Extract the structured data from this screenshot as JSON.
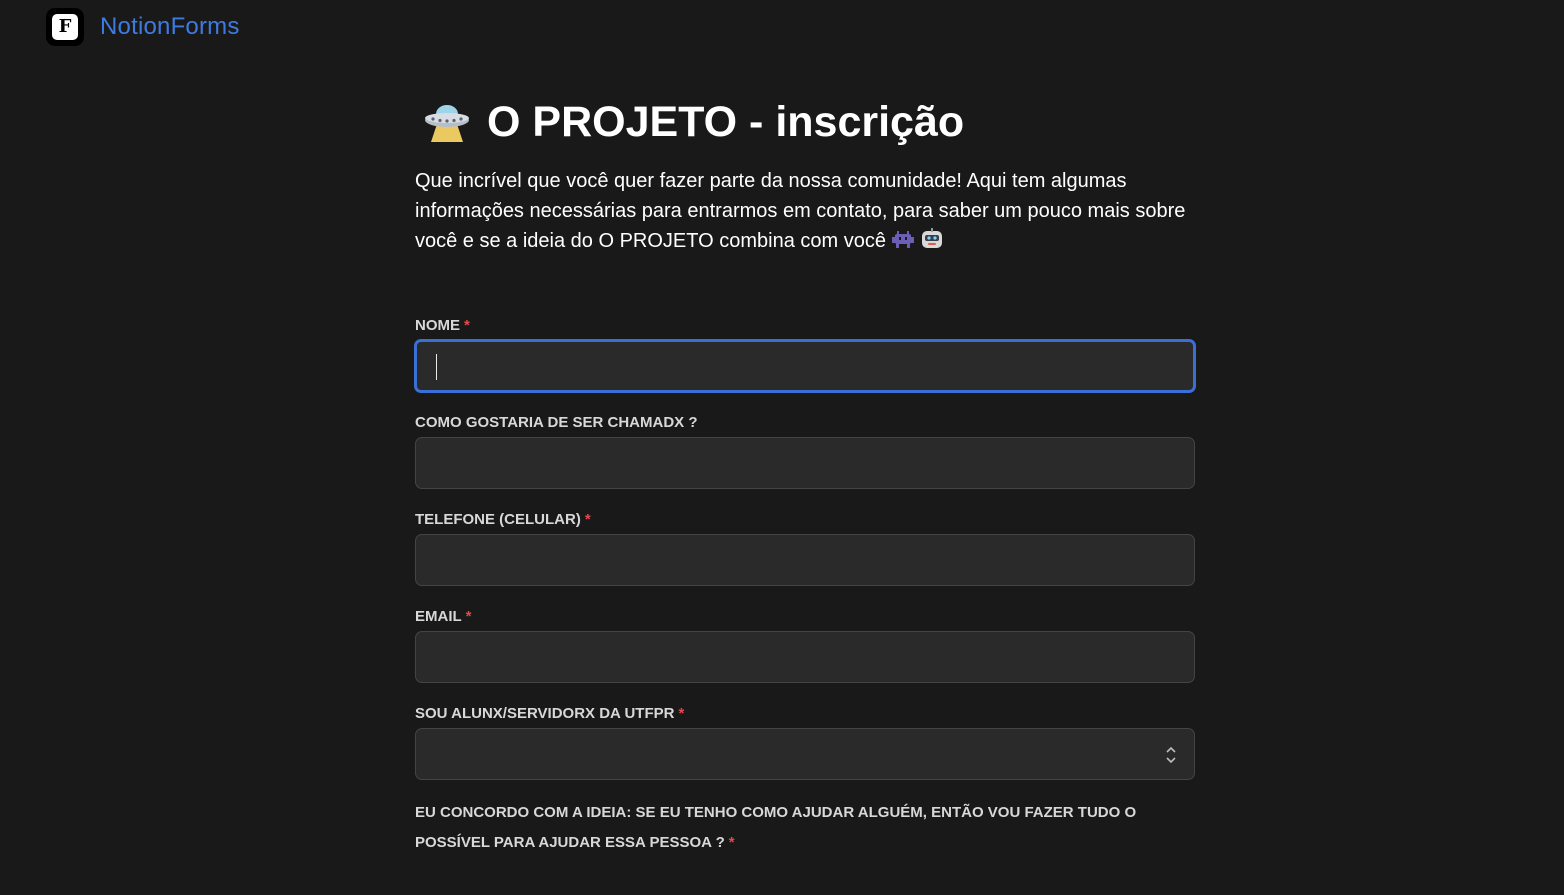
{
  "brand": {
    "logo_letter": "F",
    "name": "NotionForms",
    "color": "#3e7be0"
  },
  "page": {
    "title_icon": "ufo-icon",
    "title": "O PROJETO - inscrição",
    "description": "Que incrível que você quer fazer parte da nossa comunidade! Aqui tem algumas informações necessárias para entrarmos em contato, para saber um pouco mais sobre você e se a ideia do O PROJETO combina com você",
    "description_emojis": [
      "alien-monster-icon",
      "robot-icon"
    ]
  },
  "form": {
    "required_marker": "*",
    "fields": [
      {
        "label": "NOME",
        "required": true,
        "type": "text",
        "value": "",
        "focused": true
      },
      {
        "label": "COMO GOSTARIA DE SER CHAMADX ?",
        "required": false,
        "type": "text",
        "value": ""
      },
      {
        "label": "TELEFONE (CELULAR)",
        "required": true,
        "type": "text",
        "value": ""
      },
      {
        "label": "EMAIL",
        "required": true,
        "type": "text",
        "value": ""
      },
      {
        "label": "SOU ALUNX/SERVIDORX DA UTFPR",
        "required": true,
        "type": "select",
        "value": ""
      },
      {
        "label": "EU CONCORDO COM A IDEIA: SE EU TENHO COMO AJUDAR ALGUÉM, ENTÃO VOU FAZER TUDO O POSSÍVEL PARA AJUDAR ESSA PESSOA ?",
        "required": true,
        "type": "text",
        "value": ""
      }
    ]
  },
  "colors": {
    "background": "#191919",
    "input_bg": "#2a2a2a",
    "focus_border": "#3b6fd8",
    "required": "#e5484d"
  }
}
